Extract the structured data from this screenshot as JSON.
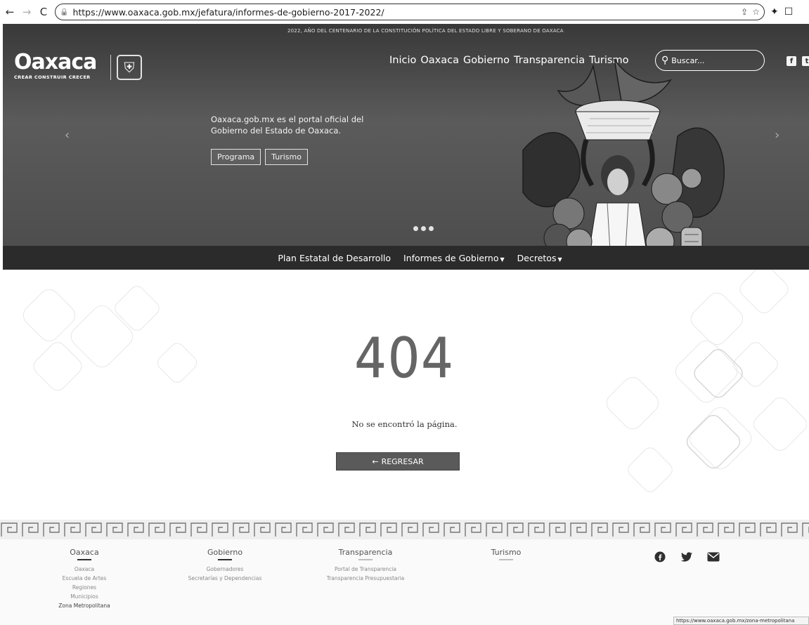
{
  "browser": {
    "url": "https://www.oaxaca.gob.mx/jefatura/informes-de-gobierno-2017-2022/",
    "back_icon": "arrow-left-icon",
    "forward_icon": "arrow-right-icon",
    "reload_icon": "reload-icon",
    "status_url": "https://www.oaxaca.gob.mx/zona-metropolitana"
  },
  "header": {
    "topline": "2022, AÑO DEL CENTENARIO DE LA CONSTITUCIÓN POLÍTICA DEL ESTADO LIBRE Y SOBERANO DE OAXACA",
    "logo_word": "Oaxaca",
    "logo_tagline": "CREAR  CONSTRUIR  CRECER",
    "nav": [
      "Inicio",
      "Oaxaca",
      "Gobierno",
      "Transparencia",
      "Turismo"
    ],
    "search_placeholder": "Buscar...",
    "social": [
      "f",
      "t"
    ]
  },
  "hero": {
    "text_line1": "Oaxaca.gob.mx es el portal oficial del",
    "text_line2": "Gobierno del Estado de Oaxaca.",
    "buttons": [
      "Programa",
      "Turismo"
    ],
    "prev_arrow": "‹",
    "next_arrow": "›"
  },
  "subnav": {
    "items": [
      "Plan Estatal de Desarrollo",
      "Informes de Gobierno",
      "Decretos"
    ]
  },
  "error": {
    "code": "404",
    "message": "No se encontró la página.",
    "back_label": "REGRESAR"
  },
  "footer": {
    "columns": [
      {
        "heading": "Oaxaca",
        "links": [
          "Oaxaca",
          "Escuela de Artes",
          "Regiones",
          "Municipios",
          "Zona Metropolitana"
        ]
      },
      {
        "heading": "Gobierno",
        "links": [
          "Gobernadores",
          "Secretarías y Dependencias"
        ]
      },
      {
        "heading": "Transparencia",
        "links": [
          "Portal de Transparencia",
          "Transparencia Presupuestaria"
        ]
      },
      {
        "heading": "Turismo",
        "links": []
      }
    ],
    "social_icons": [
      "facebook-icon",
      "twitter-icon",
      "email-icon"
    ]
  },
  "colors": {
    "hero_bg": "#4d4d4d",
    "subnav_bg": "#2f2f2f",
    "button_bg": "#5c5c5c"
  }
}
